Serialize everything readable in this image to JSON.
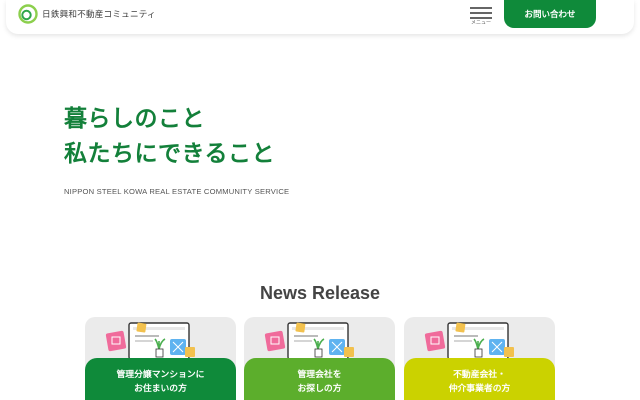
{
  "header": {
    "logo_text": "日鉄興和不動産コミュニティ",
    "menu_label": "メニュー",
    "contact_label": "お問い合わせ"
  },
  "hero": {
    "title_line1": "暮らしのこと",
    "title_line2": "私たちにできること",
    "subtitle": "NIPPON STEEL KOWA REAL ESTATE COMMUNITY SERVICE"
  },
  "news": {
    "title": "News Release"
  },
  "cards": [
    {
      "line1": "管理分譲マンションに",
      "line2": "お住まいの方",
      "color": "#0f8a3a"
    },
    {
      "line1": "管理会社を",
      "line2": "お探しの方",
      "color": "#5cae2c"
    },
    {
      "line1": "不動産会社・",
      "line2": "仲介事業者の方",
      "color": "#cbd200"
    }
  ],
  "colors": {
    "brand_green": "#0f8a3a",
    "title_green": "#13803a"
  }
}
